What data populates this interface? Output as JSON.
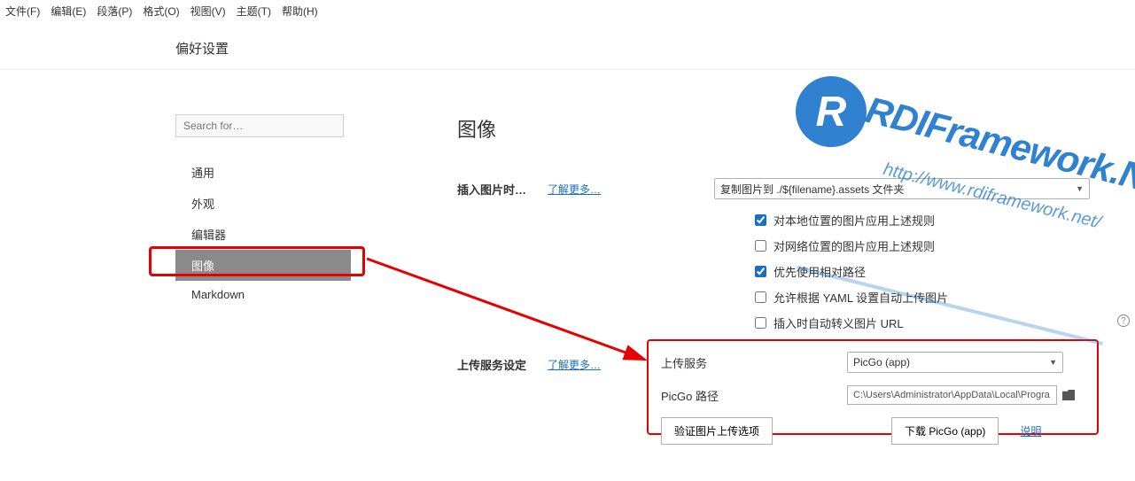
{
  "menu": [
    "文件(F)",
    "编辑(E)",
    "段落(P)",
    "格式(O)",
    "视图(V)",
    "主题(T)",
    "帮助(H)"
  ],
  "header": {
    "title": "偏好设置"
  },
  "sidebar": {
    "search_placeholder": "Search for…",
    "items": [
      {
        "label": "通用"
      },
      {
        "label": "外观"
      },
      {
        "label": "编辑器"
      },
      {
        "label": "图像"
      },
      {
        "label": "Markdown"
      }
    ]
  },
  "main": {
    "section_title": "图像",
    "insert_label": "插入图片时…",
    "learn_more": "了解更多…",
    "insert_select": "复制图片到 ./${filename}.assets 文件夹",
    "checkboxes": [
      {
        "checked": true,
        "label": "对本地位置的图片应用上述规则"
      },
      {
        "checked": false,
        "label": "对网络位置的图片应用上述规则"
      },
      {
        "checked": true,
        "label": "优先使用相对路径"
      },
      {
        "checked": false,
        "label": "允许根据 YAML 设置自动上传图片"
      },
      {
        "checked": false,
        "label": "插入时自动转义图片 URL"
      }
    ],
    "upload_label": "上传服务设定",
    "upload": {
      "service_label": "上传服务",
      "service_value": "PicGo (app)",
      "path_label": "PicGo 路径",
      "path_value": "C:\\Users\\Administrator\\AppData\\Local\\Progra",
      "btn_validate": "验证图片上传选项",
      "btn_download": "下载 PicGo (app)",
      "link_help": "说明"
    }
  },
  "watermark": {
    "brand": "RDIFramework.NET",
    "url": "http://www.rdiframework.net/",
    "letter": "R"
  }
}
